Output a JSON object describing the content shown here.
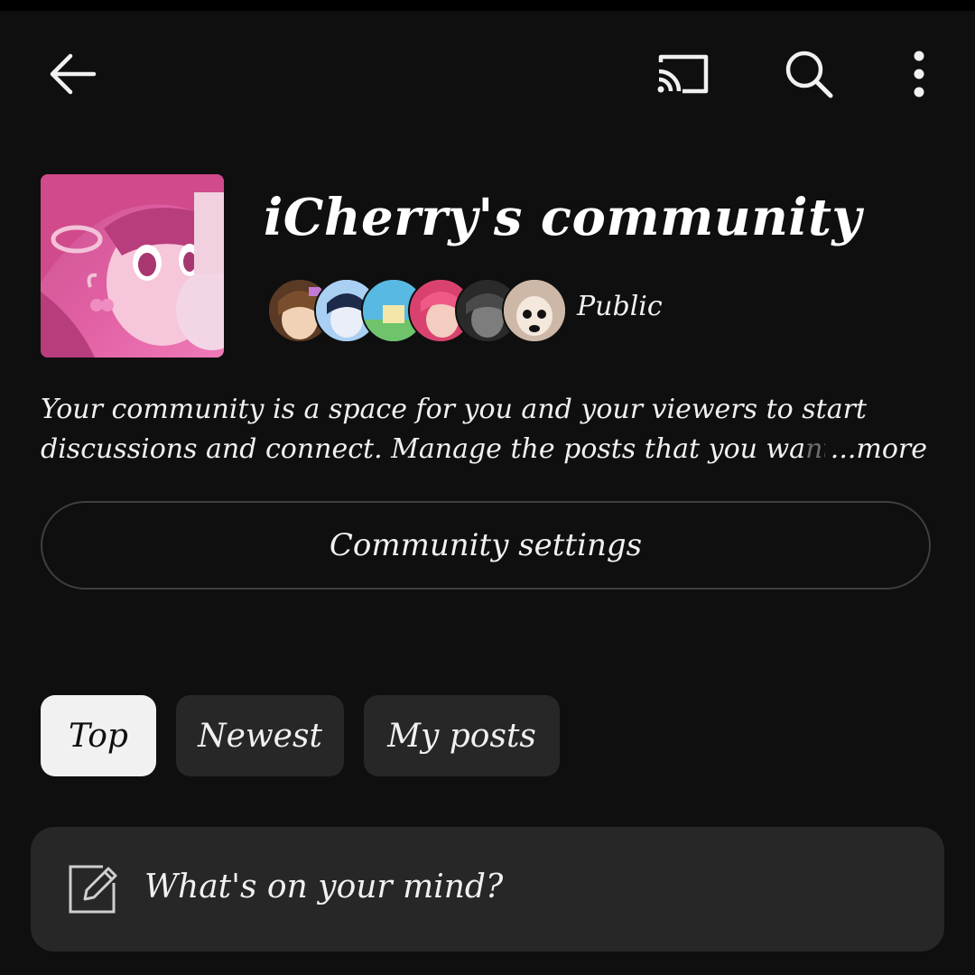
{
  "header": {
    "back_icon": "arrow-left-icon",
    "cast_icon": "cast-icon",
    "search_icon": "search-icon",
    "more_icon": "more-vertical-icon"
  },
  "community": {
    "title": "iCherry's community",
    "visibility": "Public",
    "member_avatar_count": 6,
    "description_line1": "Your community is a space for you and your viewers to start",
    "description_line2_visible": "discussions and connect. Manage the posts that you wa",
    "description_line2_faded": "nt",
    "more_label": "...more",
    "settings_button_label": "Community settings"
  },
  "filters": {
    "chips": [
      {
        "label": "Top",
        "selected": true
      },
      {
        "label": "Newest",
        "selected": false
      },
      {
        "label": "My posts",
        "selected": false
      }
    ]
  },
  "composer": {
    "icon": "edit-icon",
    "placeholder": "What's on your mind?"
  },
  "colors": {
    "background": "#0f0f0f",
    "surface": "#272727",
    "text": "#f1f1f1",
    "avatar_pink": "#e0529a"
  }
}
